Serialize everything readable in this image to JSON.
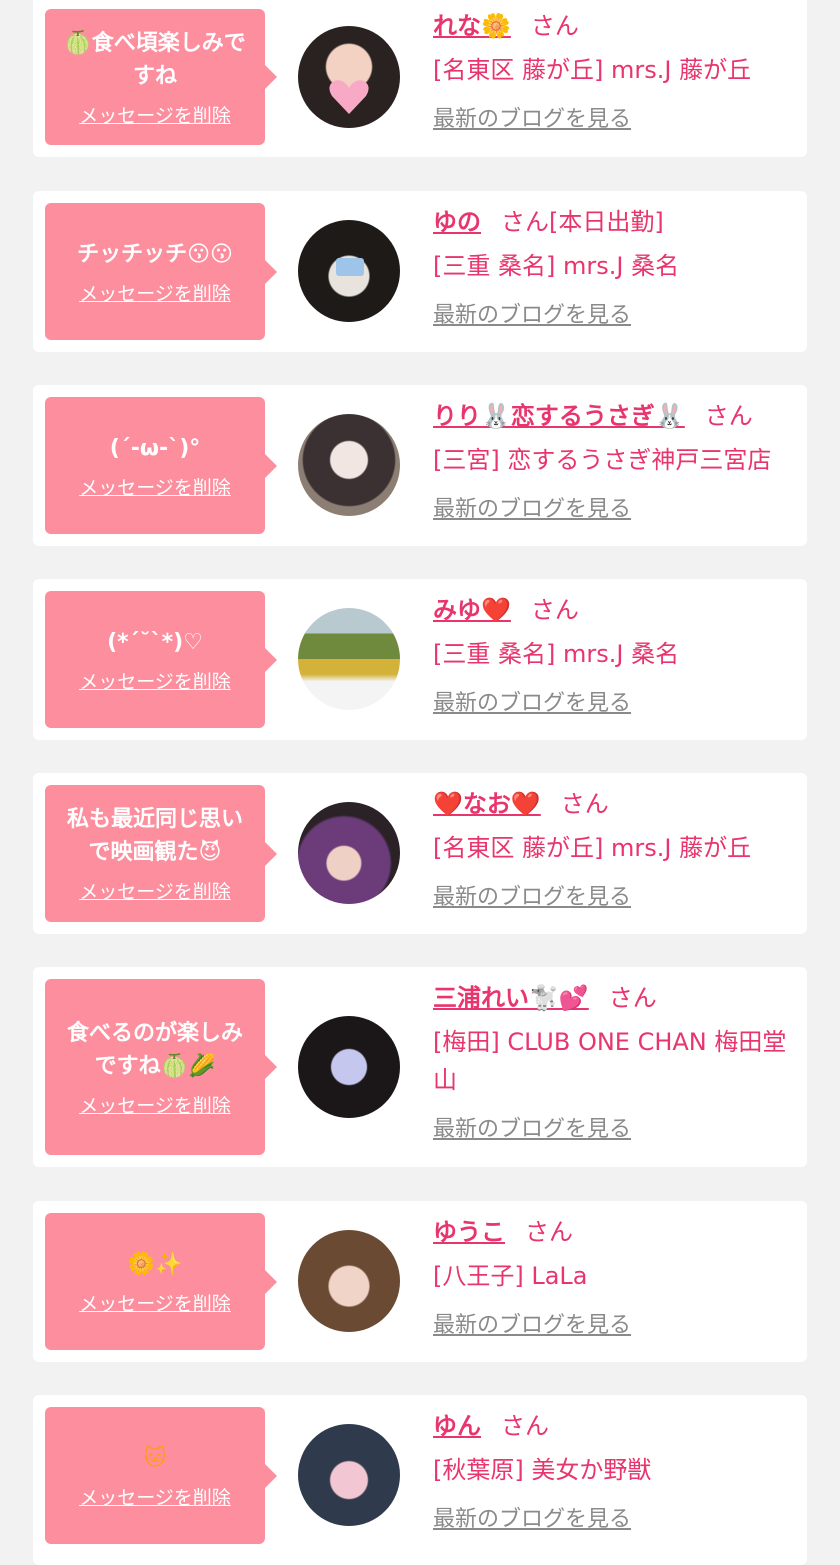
{
  "delete_label": "メッセージを削除",
  "blog_label": "最新のブログを見る",
  "honorific": "さん",
  "cards": [
    {
      "message": "🍈食べ頃楽しみですね",
      "name": "れな🌼",
      "name_suffix": "",
      "shop": "[名東区 藤が丘] mrs.J 藤が丘"
    },
    {
      "message": "チッチッチ😗😗",
      "name": "ゆの",
      "name_suffix": "[本日出勤]",
      "shop": "[三重 桑名] mrs.J 桑名"
    },
    {
      "message": "(´-ω-`)°",
      "name": "りり🐰恋するうさぎ🐰",
      "name_suffix": "",
      "shop": "[三宮] 恋するうさぎ神戸三宮店"
    },
    {
      "message": "(*´˘`*)♡",
      "name": "みゆ❤️",
      "name_suffix": "",
      "shop": "[三重 桑名] mrs.J 桑名"
    },
    {
      "message": "私も最近同じ思いで映画観た😈",
      "name": "❤️なお❤️",
      "name_suffix": "",
      "shop": "[名東区 藤が丘] mrs.J 藤が丘"
    },
    {
      "message": "食べるのが楽しみですね🍈🌽",
      "name": "三浦れい🐩💕",
      "name_suffix": "",
      "shop": "[梅田] CLUB ONE CHAN 梅田堂山"
    },
    {
      "message": "🌼✨",
      "name": "ゆうこ",
      "name_suffix": "",
      "shop": "[八王子] LaLa"
    },
    {
      "message": "🐱",
      "name": "ゆん",
      "name_suffix": "",
      "shop": "[秋葉原] 美女か野獣"
    }
  ],
  "colors": {
    "accent": "#e8356d",
    "bubble": "#fd8e9e",
    "link_gray": "#8a8a8a",
    "background": "#f2f2f2"
  }
}
